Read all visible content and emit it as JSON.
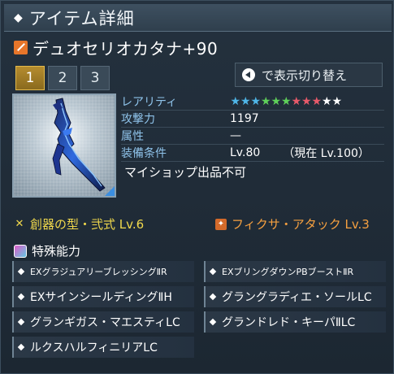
{
  "header": {
    "title": "アイテム詳細",
    "icon": "diamond-icon"
  },
  "item": {
    "name": "デュオセリオカタナ+90",
    "icon": "katana-weapon-icon",
    "icon_color": "#e7762a"
  },
  "tabs": [
    {
      "label": "1",
      "active": true
    },
    {
      "label": "2",
      "active": false
    },
    {
      "label": "3",
      "active": false
    }
  ],
  "toggle_button": {
    "label": "で表示切り替え",
    "icon": "left-arrow-circle-icon"
  },
  "stats": {
    "rarity_label": "レアリティ",
    "rarity_stars": [
      {
        "glyph": "★",
        "color": "#4fb6e8"
      },
      {
        "glyph": "★",
        "color": "#4fb6e8"
      },
      {
        "glyph": "★",
        "color": "#4fb6e8"
      },
      {
        "glyph": "★",
        "color": "#5fd05a"
      },
      {
        "glyph": "★",
        "color": "#5fd05a"
      },
      {
        "glyph": "★",
        "color": "#5fd05a"
      },
      {
        "glyph": "★",
        "color": "#e85a6a"
      },
      {
        "glyph": "★",
        "color": "#e85a6a"
      },
      {
        "glyph": "★",
        "color": "#e85a6a"
      },
      {
        "glyph": "★",
        "color": "#ffffff"
      },
      {
        "glyph": "★",
        "color": "#ffffff"
      }
    ],
    "attack_label": "攻撃力",
    "attack_value": "1197",
    "attribute_label": "属性",
    "attribute_value": "—",
    "requirement_label": "装備条件",
    "requirement_value": "Lv.80",
    "requirement_current": "（現在 Lv.100）",
    "shop_note": "マイショップ出品不可"
  },
  "potentials": {
    "left": {
      "text": "創器の型・弐式 Lv.6",
      "color": "#f0d84c",
      "icon": "crossed-swords-icon"
    },
    "right": {
      "text": "フィクサ・アタック Lv.3",
      "color": "#f5a040",
      "icon": "fixa-attack-icon"
    }
  },
  "special": {
    "title": "特殊能力",
    "icon": "special-ability-icon"
  },
  "abilities": [
    [
      "EXグラジュアリーブレッシングⅡR",
      "EXブリングダウンPBブーストⅡR"
    ],
    [
      "EXサインシールディングⅡH",
      "グラングラディエ・ソールLC"
    ],
    [
      "グランギガス・マエスティLC",
      "グランドレド・キーパⅡLC"
    ],
    [
      "ルクスハルフィニリアLC",
      ""
    ]
  ]
}
